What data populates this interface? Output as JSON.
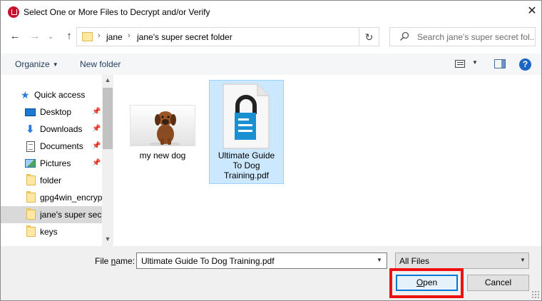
{
  "window": {
    "title": "Select One or More Files to Decrypt and/or Verify",
    "close_glyph": "✕"
  },
  "navigation": {
    "back_glyph": "←",
    "forward_glyph": "→",
    "recent_glyph": "⌄",
    "up_glyph": "↑",
    "breadcrumb": [
      "jane",
      "jane's super secret folder"
    ],
    "separator": "›",
    "refresh_glyph": "↻",
    "search_placeholder": "Search jane's super secret fol..."
  },
  "toolbar": {
    "organize_label": "Organize",
    "new_folder_label": "New folder",
    "help_glyph": "?",
    "caret": "▼"
  },
  "sidebar": {
    "pin_glyph": "📌",
    "items": [
      {
        "label": "Quick access",
        "icon": "star-icon"
      },
      {
        "label": "Desktop",
        "icon": "desktop-icon",
        "pinned": true
      },
      {
        "label": "Downloads",
        "icon": "downloads-icon",
        "pinned": true
      },
      {
        "label": "Documents",
        "icon": "documents-icon",
        "pinned": true
      },
      {
        "label": "Pictures",
        "icon": "pictures-icon",
        "pinned": true
      },
      {
        "label": "folder",
        "icon": "folder-icon"
      },
      {
        "label": "gpg4win_encryp",
        "icon": "folder-icon"
      },
      {
        "label": "jane's super secr",
        "icon": "folder-icon",
        "selected": true
      },
      {
        "label": "keys",
        "icon": "folder-icon"
      }
    ]
  },
  "files": [
    {
      "name": "my new dog",
      "icon": "dog-photo-thumbnail",
      "selected": false
    },
    {
      "name_lines": [
        "Ultimate Guide",
        "To Dog",
        "Training.pdf"
      ],
      "icon": "encrypted-pdf-icon",
      "selected": true
    }
  ],
  "footer": {
    "file_name_label_pre": "File ",
    "file_name_label_u": "n",
    "file_name_label_post": "ame:",
    "file_name_value": "Ultimate Guide To Dog Training.pdf",
    "file_type_value": "All Files",
    "open_label_u": "O",
    "open_label_rest": "pen",
    "cancel_label": "Cancel"
  },
  "colors": {
    "accent": "#0078d7",
    "highlight": "#ee1111",
    "selection": "#cce8ff",
    "pdf_icon_blue": "#1a8fd1"
  }
}
